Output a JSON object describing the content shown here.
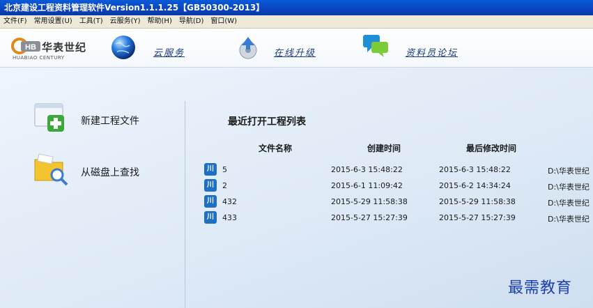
{
  "window": {
    "title": "北京建设工程资料管理软件Version1.1.1.25【GB50300-2013】"
  },
  "menu": [
    "文件(F)",
    "常用设置(U)",
    "工具(T)",
    "云服务(Y)",
    "帮助(H)",
    "导航(D)",
    "窗口(W)"
  ],
  "toolbar": {
    "logo_main": "华表世纪",
    "logo_badge": "HB",
    "logo_sub": "HUABIAO CENTURY",
    "cloud_label": "云服务",
    "upgrade_label": "在线升级",
    "forum_label": "资料员论坛"
  },
  "actions": {
    "new_project": "新建工程文件",
    "find_on_disk": "从磁盘上查找"
  },
  "recent": {
    "title": "最近打开工程列表",
    "headers": [
      "文件名称",
      "创建时间",
      "最后修改时间"
    ],
    "rows": [
      {
        "name": "5",
        "created": "2015-6-3 15:48:22",
        "modified": "2015-6-3 15:48:22",
        "path": "D:\\华表世纪"
      },
      {
        "name": "2",
        "created": "2015-6-1 11:09:42",
        "modified": "2015-6-2 14:34:24",
        "path": "D:\\华表世纪"
      },
      {
        "name": "432",
        "created": "2015-5-29 11:58:38",
        "modified": "2015-5-29 11:58:38",
        "path": "D:\\华表世纪"
      },
      {
        "name": "433",
        "created": "2015-5-27 15:27:39",
        "modified": "2015-5-27 15:27:39",
        "path": "D:\\华表世纪"
      }
    ],
    "file_icon_glyph": "川"
  },
  "watermark": "最需教育"
}
